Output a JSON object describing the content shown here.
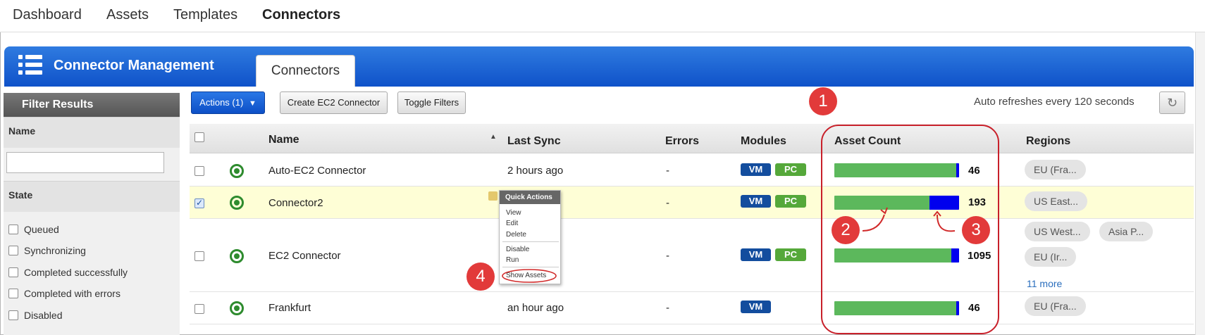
{
  "nav": [
    "Dashboard",
    "Assets",
    "Templates",
    "Connectors"
  ],
  "header": {
    "title": "Connector Management",
    "tab": "Connectors"
  },
  "filter": {
    "title": "Filter Results",
    "name_label": "Name",
    "name_value": "",
    "state_label": "State",
    "states": [
      "Queued",
      "Synchronizing",
      "Completed successfully",
      "Completed with errors",
      "Disabled"
    ]
  },
  "toolbar": {
    "actions": "Actions (1)",
    "create": "Create EC2 Connector",
    "toggle": "Toggle Filters",
    "auto_refresh": "Auto refreshes every 120 seconds"
  },
  "table": {
    "columns": [
      "Name",
      "Last Sync",
      "Errors",
      "Modules",
      "Asset Count",
      "Regions"
    ],
    "rows": [
      {
        "name": "Auto-EC2 Connector",
        "last_sync": "2 hours ago",
        "errors": "-",
        "modules": [
          "VM",
          "PC"
        ],
        "asset_count": "46",
        "green_fraction": 0.98,
        "selected": false,
        "regions": [
          "EU (Fra..."
        ]
      },
      {
        "name": "Connector2",
        "last_sync": "",
        "errors": "-",
        "modules": [
          "VM",
          "PC"
        ],
        "asset_count": "193",
        "green_fraction": 0.76,
        "selected": true,
        "regions": [
          "US East..."
        ]
      },
      {
        "name": "EC2 Connector",
        "last_sync": "",
        "errors": "-",
        "modules": [
          "VM",
          "PC"
        ],
        "asset_count": "1095",
        "green_fraction": 0.94,
        "selected": false,
        "regions": [
          "US West...",
          "Asia P...",
          "EU (Ir..."
        ],
        "more": "11 more"
      },
      {
        "name": "Frankfurt",
        "last_sync": "an hour ago",
        "errors": "-",
        "modules": [
          "VM"
        ],
        "asset_count": "46",
        "green_fraction": 0.98,
        "selected": false,
        "regions": [
          "EU (Fra..."
        ]
      }
    ]
  },
  "quick_actions": {
    "title": "Quick Actions",
    "items": [
      "View",
      "Edit",
      "Delete",
      "Disable",
      "Run",
      "Show Assets"
    ]
  },
  "callouts": [
    "1",
    "2",
    "3",
    "4"
  ],
  "colors": {
    "header_blue": "#1560d4",
    "bar_green": "#5cb85c",
    "bar_blue": "#0000ee",
    "callout_red": "#e23a3a",
    "selected_row": "#fefed6"
  }
}
